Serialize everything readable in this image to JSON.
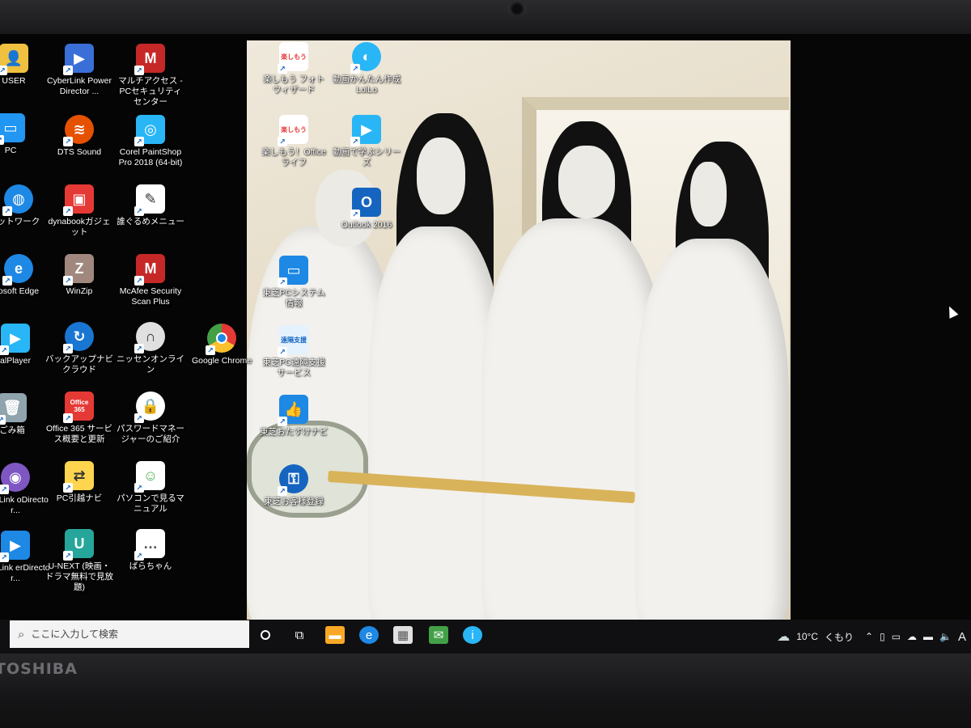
{
  "brand": "TOSHIBA",
  "desktop_icons": {
    "user": {
      "label": "USER",
      "color": "#f0c040",
      "icon": "user-folder-icon"
    },
    "cyberlink_pd": {
      "label": "CyberLink PowerDirector ...",
      "color": "#3a6fd8",
      "icon": "video-camera-icon"
    },
    "mcafee_multi": {
      "label": "マルチアクセス - PCセキュリティセンター",
      "color": "#c62828",
      "icon": "mcafee-icon"
    },
    "pc": {
      "label": "PC",
      "color": "#2196f3",
      "icon": "monitor-icon"
    },
    "dts": {
      "label": "DTS Sound",
      "color": "#e65100",
      "icon": "dts-icon"
    },
    "corel": {
      "label": "Corel PaintShop Pro 2018 (64-bit)",
      "color": "#29b6f6",
      "icon": "camera-icon"
    },
    "network": {
      "label": "ットワーク",
      "color": "#1e88e5",
      "icon": "globe-icon"
    },
    "dynabook": {
      "label": "dynabookガジェット",
      "color": "#e53935",
      "icon": "gadget-icon"
    },
    "menu": {
      "label": "誰ぐるめメニュー",
      "color": "#ffffff",
      "icon": "pencil-note-icon"
    },
    "edge": {
      "label": "osoft Edge",
      "color": "#1e88e5",
      "icon": "edge-icon"
    },
    "winzip": {
      "label": "WinZip",
      "color": "#a1887f",
      "icon": "zip-icon"
    },
    "mcafee_scan": {
      "label": "McAfee Security Scan Plus",
      "color": "#c62828",
      "icon": "mcafee-icon"
    },
    "realplayer": {
      "label": "alPlayer",
      "color": "#29b6f6",
      "icon": "realplayer-icon"
    },
    "backup": {
      "label": "バックアップナビ クラウド",
      "color": "#1976d2",
      "icon": "backup-icon"
    },
    "nissen": {
      "label": "ニッセンオンライン",
      "color": "#e0e0e0",
      "icon": "headset-icon"
    },
    "chrome": {
      "label": "Google Chrome",
      "color": "#4caf50",
      "icon": "chrome-icon"
    },
    "trash": {
      "label": "ごみ箱",
      "color": "#90a4ae",
      "icon": "trash-icon"
    },
    "office365": {
      "label": "Office 365 サービス概要と更新",
      "color": "#e53935",
      "icon": "office-icon",
      "badge": "Office 365"
    },
    "password": {
      "label": "パスワードマネージャーのご紹介",
      "color": "#ffffff",
      "icon": "lock-icon"
    },
    "cyberlink_pd2": {
      "label": "yberLink oDirector...",
      "color": "#7e57c2",
      "icon": "cyberlink-icon"
    },
    "pc_move": {
      "label": "PC引越ナビ",
      "color": "#ffd54f",
      "icon": "folder-move-icon"
    },
    "manual": {
      "label": "パソコンで見るマニュアル",
      "color": "#ffffff",
      "icon": "manual-icon"
    },
    "cyberlink_pd3": {
      "label": "yberLink erDirector...",
      "color": "#1e88e5",
      "icon": "video-camera-icon"
    },
    "unext": {
      "label": "U-NEXT (映画・ドラマ無料で見放題)",
      "color": "#26a69a",
      "icon": "unext-icon",
      "glyph": "U"
    },
    "bara": {
      "label": "ばらちゃん",
      "color": "#ffffff",
      "icon": "chat-icon"
    },
    "photo_wizard": {
      "label": "楽しもう フォトウィザード",
      "color": "#ffffff",
      "icon": "photo-wizard-icon",
      "badge": "楽しもう"
    },
    "loilo": {
      "label": "動画かんたん作成 LoiLo",
      "color": "#29b6f6",
      "icon": "loilo-icon"
    },
    "office_life": {
      "label": "楽しもう！Officeライフ",
      "color": "#ffffff",
      "icon": "office-life-icon",
      "badge": "楽しもう"
    },
    "video_learn": {
      "label": "動画で学ぶシリーズ",
      "color": "#29b6f6",
      "icon": "video-learn-icon"
    },
    "outlook": {
      "label": "Outlook 2016",
      "color": "#1565c0",
      "icon": "outlook-icon",
      "glyph": "O"
    },
    "sysinfo": {
      "label": "東芝PCシステム情報",
      "color": "#1e88e5",
      "icon": "system-info-icon"
    },
    "remote": {
      "label": "東芝PC遠隔支援サービス",
      "color": "#e3f2fd",
      "icon": "remote-support-icon",
      "badge": "遠隔支援"
    },
    "osusume": {
      "label": "東芝おたすけナビ",
      "color": "#1e88e5",
      "icon": "thumbs-up-icon"
    },
    "register": {
      "label": "東芝お客様登録",
      "color": "#1565c0",
      "icon": "key-icon"
    }
  },
  "taskbar": {
    "search_placeholder": "ここに入力して検索",
    "weather_temp": "10°C",
    "weather_desc": "くもり",
    "ime": "A"
  }
}
